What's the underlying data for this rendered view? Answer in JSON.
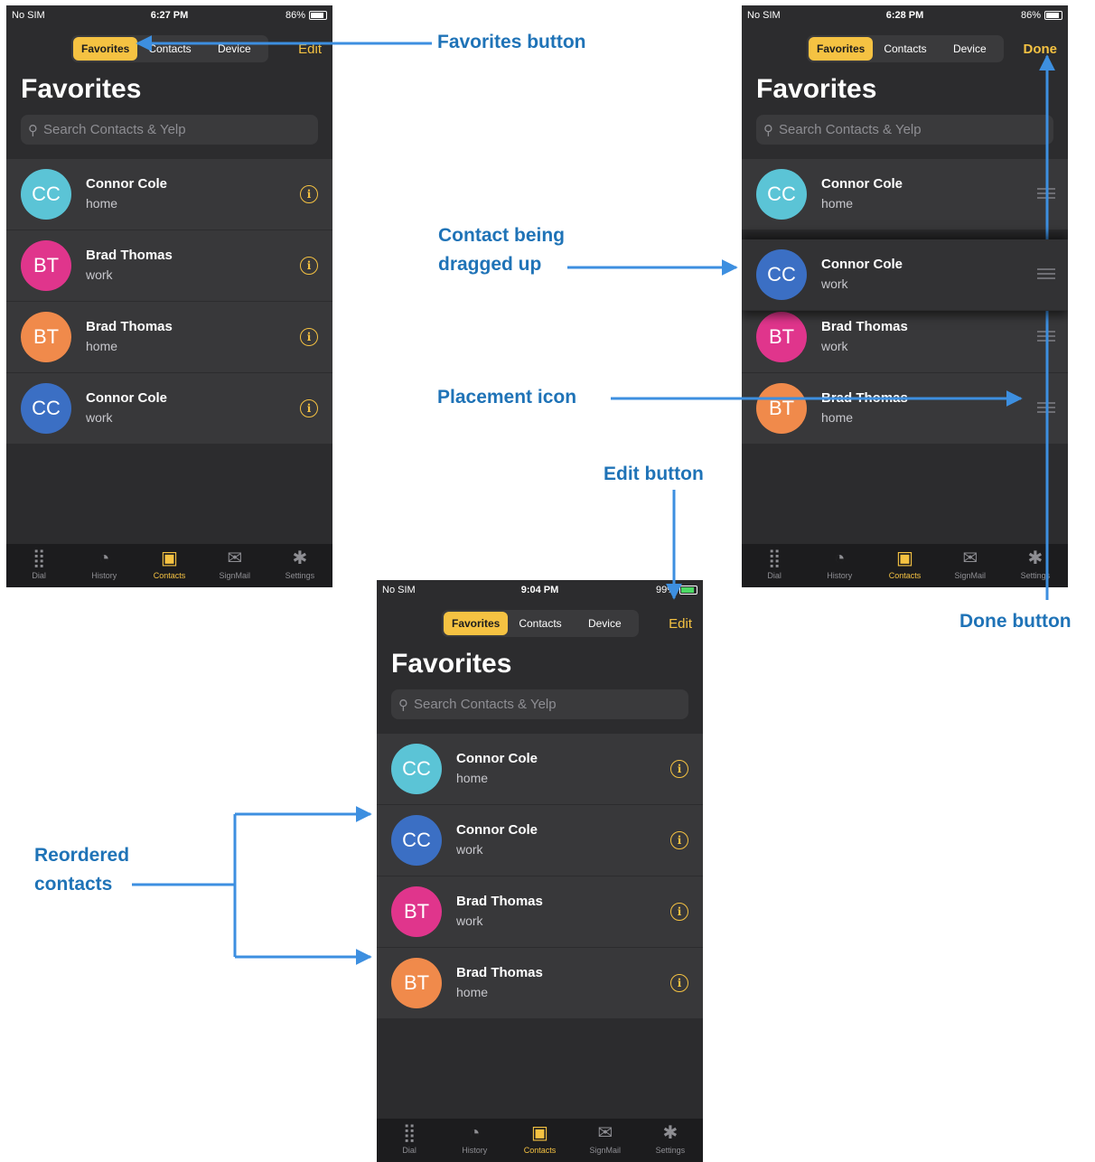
{
  "tabs": [
    "Dial",
    "History",
    "Contacts",
    "SignMail",
    "Settings"
  ],
  "segments": [
    "Favorites",
    "Contacts",
    "Device"
  ],
  "title": "Favorites",
  "search_placeholder": "Search Contacts & Yelp",
  "carrier": "No SIM",
  "screens": [
    {
      "time": "6:27 PM",
      "battery": "86%",
      "nav_button": "Edit",
      "mode": "info",
      "contacts": [
        {
          "initials": "CC",
          "name": "Connor Cole",
          "type": "home",
          "color": "#5bc4d6"
        },
        {
          "initials": "BT",
          "name": "Brad Thomas",
          "type": "work",
          "color": "#e0358c"
        },
        {
          "initials": "BT",
          "name": "Brad Thomas",
          "type": "home",
          "color": "#f08a4b"
        },
        {
          "initials": "CC",
          "name": "Connor Cole",
          "type": "work",
          "color": "#3b6fc4"
        }
      ]
    },
    {
      "time": "6:28 PM",
      "battery": "86%",
      "nav_button": "Done",
      "mode": "edit",
      "contacts": [
        {
          "initials": "CC",
          "name": "Connor Cole",
          "type": "home",
          "color": "#5bc4d6"
        },
        {
          "initials": "CC",
          "name": "Connor Cole",
          "type": "work",
          "color": "#3b6fc4"
        },
        {
          "initials": "BT",
          "name": "Brad Thomas",
          "type": "work",
          "color": "#e0358c"
        },
        {
          "initials": "BT",
          "name": "Brad Thomas",
          "type": "home",
          "color": "#f08a4b"
        }
      ]
    },
    {
      "time": "9:04 PM",
      "battery": "99%",
      "nav_button": "Edit",
      "mode": "info",
      "contacts": [
        {
          "initials": "CC",
          "name": "Connor Cole",
          "type": "home",
          "color": "#5bc4d6"
        },
        {
          "initials": "CC",
          "name": "Connor Cole",
          "type": "work",
          "color": "#3b6fc4"
        },
        {
          "initials": "BT",
          "name": "Brad Thomas",
          "type": "work",
          "color": "#e0358c"
        },
        {
          "initials": "BT",
          "name": "Brad Thomas",
          "type": "home",
          "color": "#f08a4b"
        }
      ]
    }
  ],
  "annotations": {
    "favorites_button": "Favorites button",
    "contact_dragged": "Contact being dragged up",
    "placement_icon": "Placement icon",
    "edit_button": "Edit button",
    "done_button": "Done button",
    "reordered": "Reordered contacts"
  },
  "accent_color": "#f5c242",
  "annotation_color": "#1f73b7"
}
